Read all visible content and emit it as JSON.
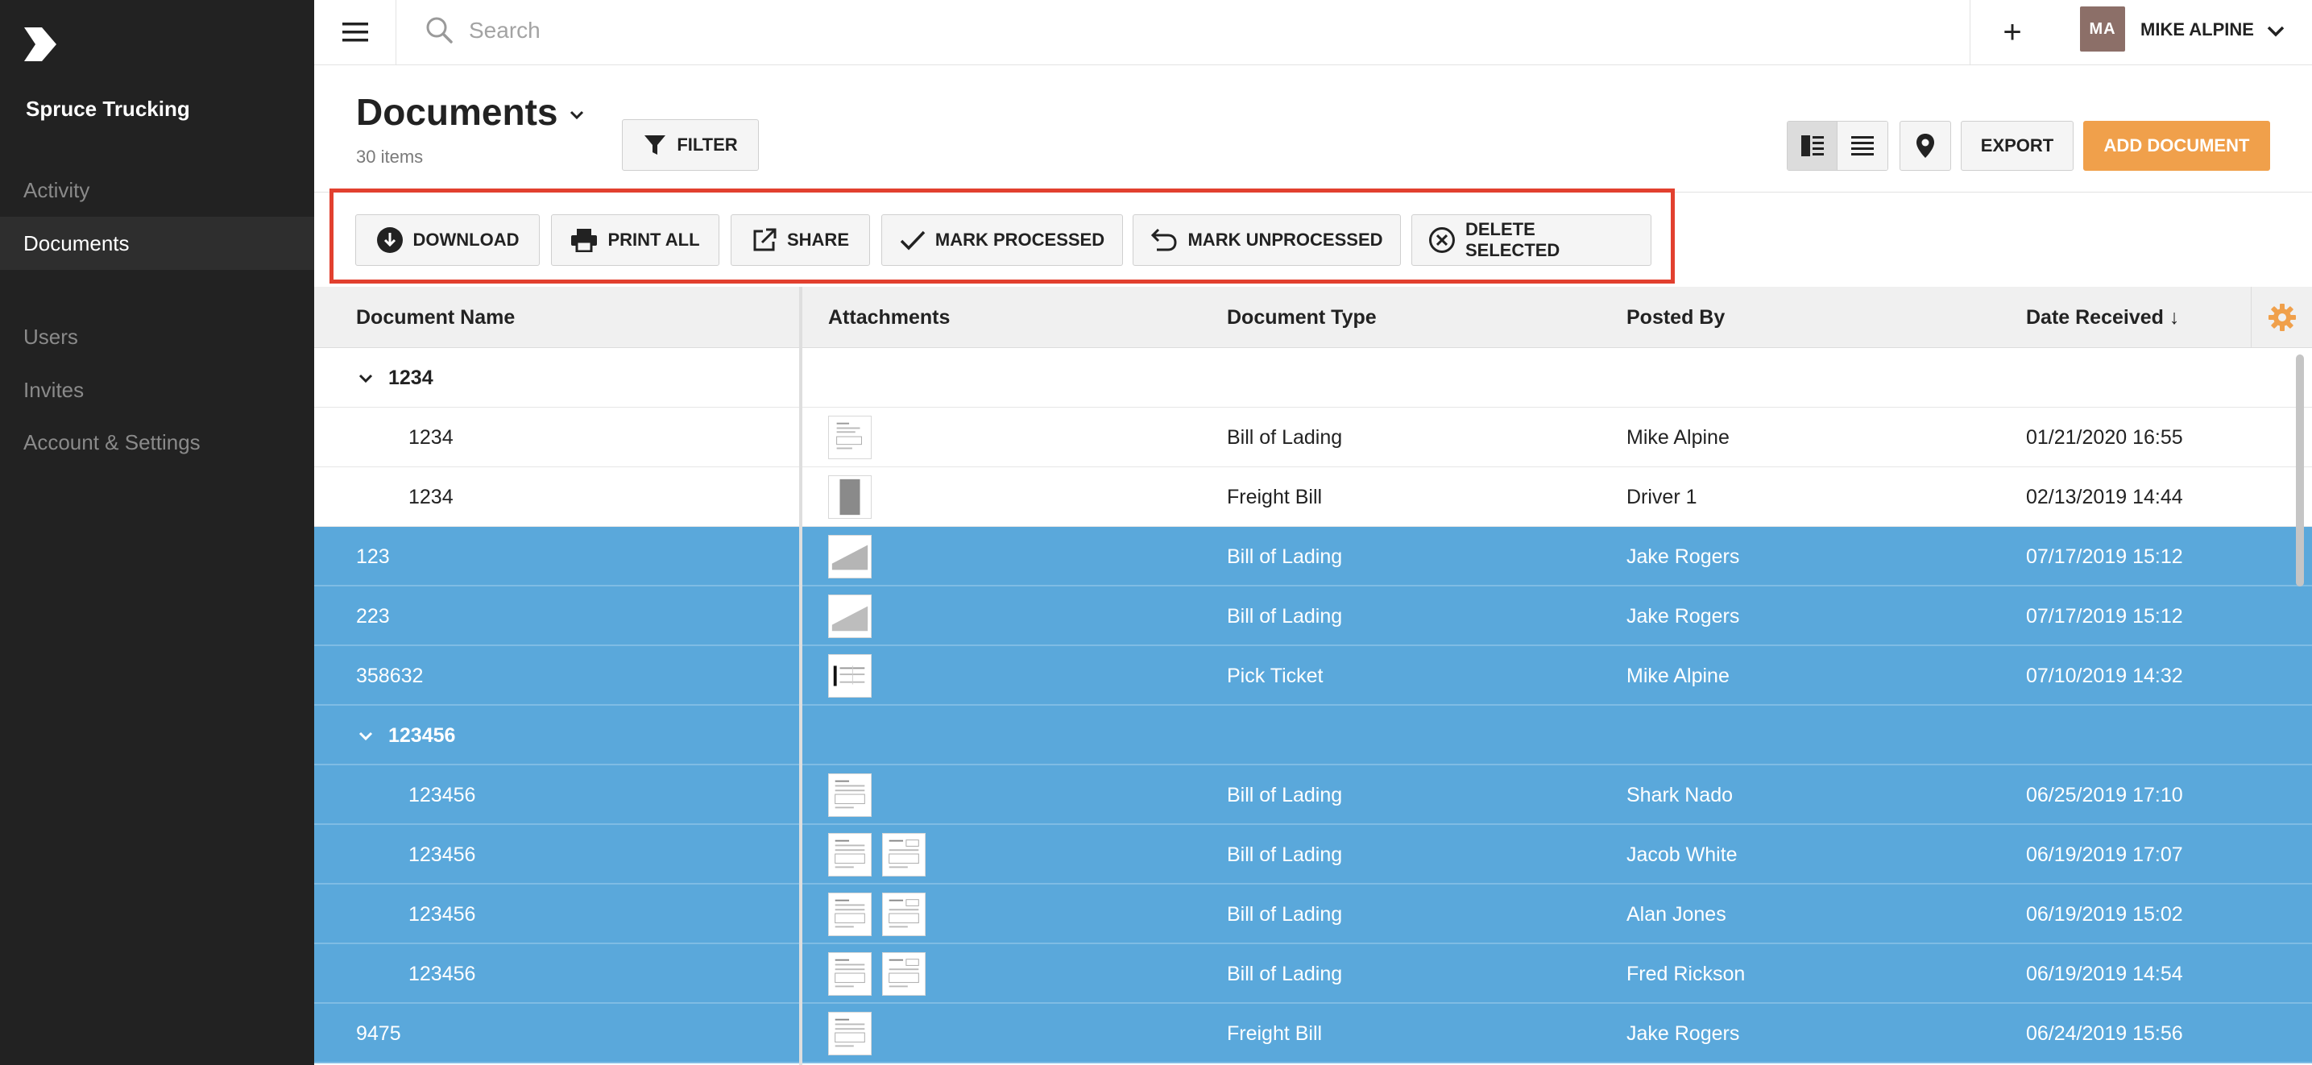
{
  "sidebar": {
    "company": "Spruce Trucking",
    "items": [
      {
        "label": "Activity"
      },
      {
        "label": "Documents"
      },
      {
        "label": "Users"
      },
      {
        "label": "Invites"
      },
      {
        "label": "Account & Settings"
      }
    ]
  },
  "topbar": {
    "search_placeholder": "Search",
    "add_label": "+",
    "avatar_initials": "MA",
    "user_name": "MIKE ALPINE"
  },
  "page": {
    "title": "Documents",
    "item_count": "30 items",
    "filter_label": "FILTER",
    "export_label": "EXPORT",
    "add_document_label": "ADD DOCUMENT"
  },
  "actions": {
    "download": "DOWNLOAD",
    "print_all": "PRINT ALL",
    "share": "SHARE",
    "mark_processed": "MARK PROCESSED",
    "mark_unprocessed": "MARK UNPROCESSED",
    "delete_selected": "DELETE SELECTED"
  },
  "table": {
    "columns": {
      "name": "Document Name",
      "attachments": "Attachments",
      "type": "Document Type",
      "posted_by": "Posted By",
      "date": "Date Received ↓"
    },
    "rows": [
      {
        "kind": "group",
        "name": "1234",
        "selected": false
      },
      {
        "kind": "child",
        "name": "1234",
        "type": "Bill of Lading",
        "posted_by": "Mike Alpine",
        "date": "01/21/2020 16:55",
        "selected": false
      },
      {
        "kind": "child",
        "name": "1234",
        "type": "Freight Bill",
        "posted_by": "Driver 1",
        "date": "02/13/2019 14:44",
        "selected": false
      },
      {
        "kind": "doc",
        "name": "123",
        "type": "Bill of Lading",
        "posted_by": "Jake Rogers",
        "date": "07/17/2019 15:12",
        "selected": true
      },
      {
        "kind": "doc",
        "name": "223",
        "type": "Bill of Lading",
        "posted_by": "Jake Rogers",
        "date": "07/17/2019 15:12",
        "selected": true
      },
      {
        "kind": "doc",
        "name": "358632",
        "type": "Pick Ticket",
        "posted_by": "Mike Alpine",
        "date": "07/10/2019 14:32",
        "selected": true
      },
      {
        "kind": "group",
        "name": "123456",
        "selected": true
      },
      {
        "kind": "child",
        "name": "123456",
        "type": "Bill of Lading",
        "posted_by": "Shark Nado",
        "date": "06/25/2019 17:10",
        "selected": true
      },
      {
        "kind": "child",
        "name": "123456",
        "type": "Bill of Lading",
        "posted_by": "Jacob White",
        "date": "06/19/2019 17:07",
        "selected": true
      },
      {
        "kind": "child",
        "name": "123456",
        "type": "Bill of Lading",
        "posted_by": "Alan Jones",
        "date": "06/19/2019 15:02",
        "selected": true
      },
      {
        "kind": "child",
        "name": "123456",
        "type": "Bill of Lading",
        "posted_by": "Fred Rickson",
        "date": "06/19/2019 14:54",
        "selected": true
      },
      {
        "kind": "doc",
        "name": "9475",
        "type": "Freight Bill",
        "posted_by": "Jake Rogers",
        "date": "06/24/2019 15:56",
        "selected": true
      }
    ]
  },
  "colors": {
    "sidebar_bg": "#222222",
    "selected_row": "#5aa8db",
    "accent_orange": "#f0a04b",
    "highlight_frame": "#e2402f"
  }
}
